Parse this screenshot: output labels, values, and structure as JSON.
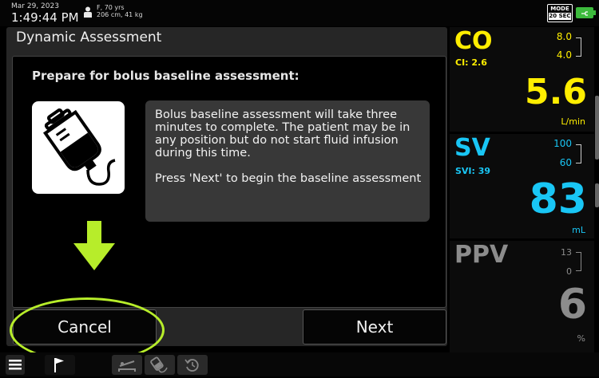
{
  "status_bar": {
    "date": "Mar 29, 2023",
    "time": "1:49:44 PM",
    "patient_line1": "F, 70 yrs",
    "patient_line2": "206 cm, 41 kg",
    "mode_label": "MODE",
    "mode_value": "20 SEC"
  },
  "dialog": {
    "title": "Dynamic Assessment",
    "prompt": "Prepare for bolus baseline assessment:",
    "info_paragraph1": "Bolus baseline assessment will take three minutes to complete. The patient may be in any position but do not start fluid infusion during this time.",
    "info_paragraph2": "Press 'Next' to begin the baseline assessment",
    "cancel_label": "Cancel",
    "next_label": "Next"
  },
  "parameters": [
    {
      "name": "CO",
      "sub": "CI: 2.6",
      "hi": "8.0",
      "lo": "4.0",
      "value": "5.6",
      "unit": "L/min",
      "color": "#ffee00"
    },
    {
      "name": "SV",
      "sub": "SVI: 39",
      "hi": "100",
      "lo": "60",
      "value": "83",
      "unit": "mL",
      "color": "#19c6f5"
    },
    {
      "name": "PPV",
      "sub": "",
      "hi": "13",
      "lo": "0",
      "value": "6",
      "unit": "%",
      "color": "#8c8c8c"
    }
  ],
  "toolbar": {
    "icons": [
      "menu-icon",
      "flag-icon",
      "bed-icon",
      "bolus-icon",
      "history-icon"
    ]
  },
  "colors": {
    "highlight": "#b7ed2a",
    "co": "#ffee00",
    "sv": "#19c6f5",
    "battery": "#3dbb3d"
  }
}
